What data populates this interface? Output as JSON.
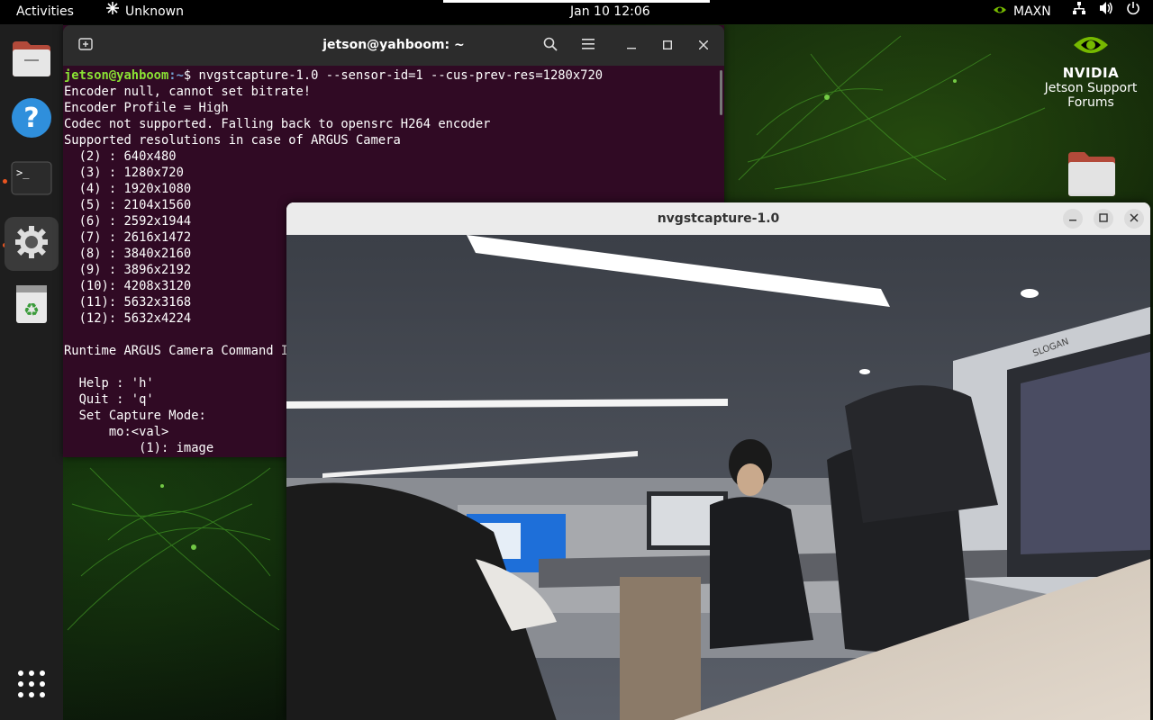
{
  "topbar": {
    "activities": "Activities",
    "app_menu": "Unknown",
    "clock": "Jan 10  12:06",
    "power_mode": "MAXN",
    "icons": [
      "network-icon",
      "volume-icon",
      "power-icon"
    ]
  },
  "dock": {
    "items": [
      {
        "name": "files",
        "icon": "folder-icon"
      },
      {
        "name": "help",
        "icon": "help-icon"
      },
      {
        "name": "terminal",
        "icon": "terminal-icon",
        "running": true
      },
      {
        "name": "settings",
        "icon": "gear-icon",
        "running": true,
        "active": true
      },
      {
        "name": "trash",
        "icon": "trash-icon"
      }
    ],
    "apps_grid": "app-grid-icon"
  },
  "desktop": {
    "nvidia_brand": "NVIDIA",
    "nvidia_label_line1": "Jetson Support",
    "nvidia_label_line2": "Forums"
  },
  "terminal": {
    "title": "jetson@yahboom: ~",
    "prompt_user": "jetson@yahboom",
    "prompt_path": ":~",
    "prompt_symbol": "$ ",
    "command": "nvgstcapture-1.0 --sensor-id=1 --cus-prev-res=1280x720",
    "output": [
      "Encoder null, cannot set bitrate!",
      "Encoder Profile = High",
      "Codec not supported. Falling back to opensrc H264 encoder",
      "Supported resolutions in case of ARGUS Camera",
      "  (2) : 640x480",
      "  (3) : 1280x720",
      "  (4) : 1920x1080",
      "  (5) : 2104x1560",
      "  (6) : 2592x1944",
      "  (7) : 2616x1472",
      "  (8) : 3840x2160",
      "  (9) : 3896x2192",
      "  (10): 4208x3120",
      "  (11): 5632x3168",
      "  (12): 5632x4224",
      "",
      "Runtime ARGUS Camera Command Integration",
      "",
      "  Help : 'h'",
      "  Quit : 'q'",
      "  Set Capture Mode:",
      "      mo:<val>",
      "          (1): image"
    ]
  },
  "camera_window": {
    "title": "nvgstcapture-1.0",
    "preview_sign": "SLOGAN"
  }
}
